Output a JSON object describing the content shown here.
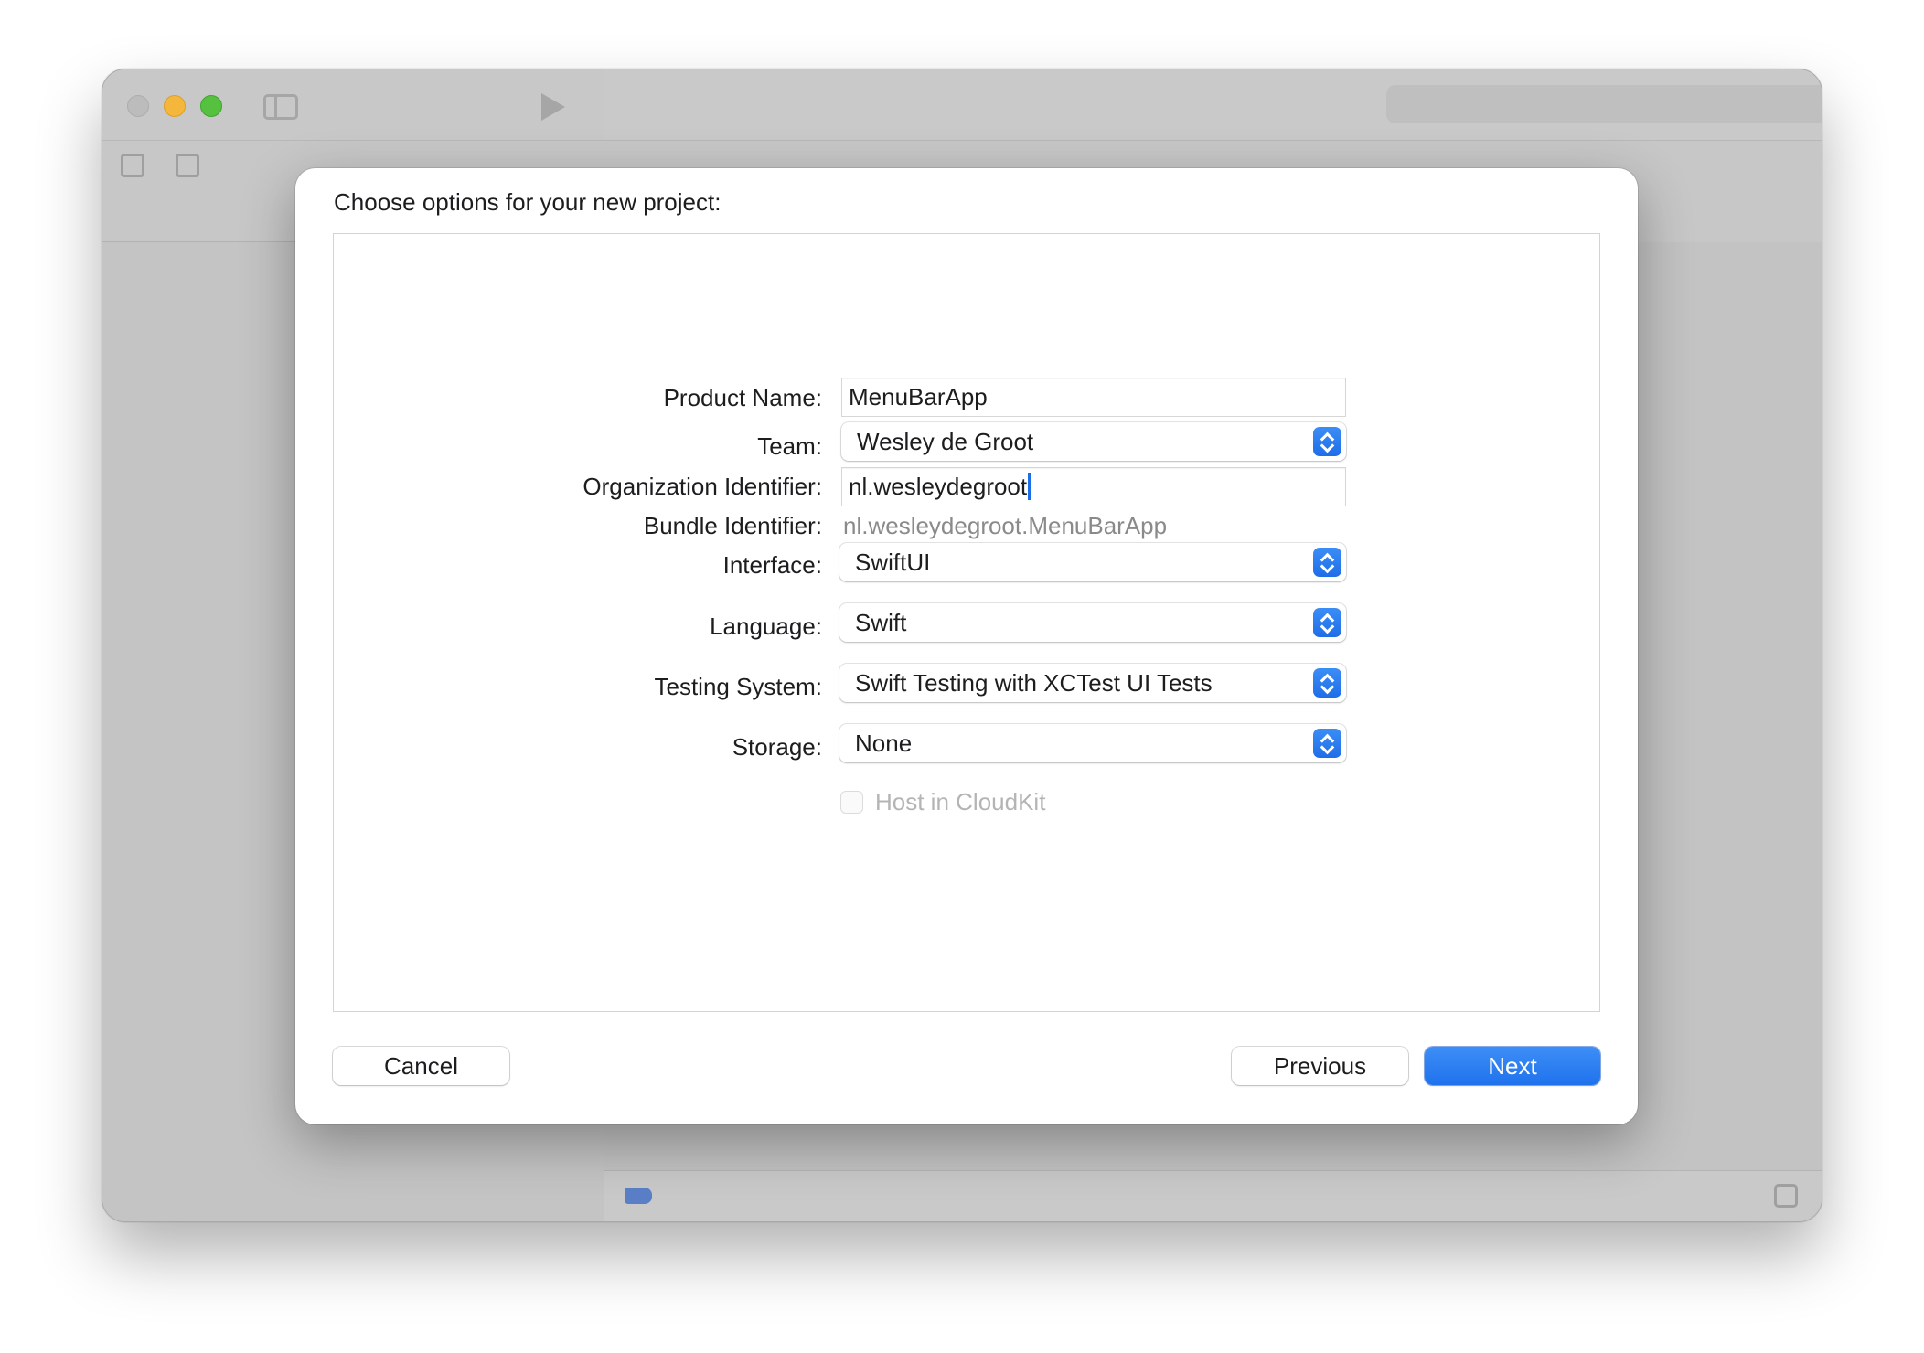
{
  "window": {
    "title_bar": {
      "traffic_lights": [
        "close",
        "minimize",
        "zoom"
      ]
    },
    "icons": {
      "sidebar_toggle": "sidebar-left-icon",
      "run": "play-icon",
      "library": "plus-icon",
      "inspector_toggle": "sidebar-right-icon",
      "navigator": [
        "folder-icon",
        "source-control-icon",
        "bookmark-icon",
        "search-icon",
        "warning-icon",
        "test-icon",
        "debug-icon",
        "breakpoint-icon",
        "report-icon"
      ]
    }
  },
  "dialog": {
    "title": "Choose options for your new project:",
    "fields": {
      "product_name": {
        "label": "Product Name:",
        "value": "MenuBarApp"
      },
      "team": {
        "label": "Team:",
        "value": "Wesley de Groot"
      },
      "organization_identifier": {
        "label": "Organization Identifier:",
        "value": "nl.wesleydegroot"
      },
      "bundle_identifier": {
        "label": "Bundle Identifier:",
        "value": "nl.wesleydegroot.MenuBarApp"
      },
      "interface": {
        "label": "Interface:",
        "value": "SwiftUI"
      },
      "language": {
        "label": "Language:",
        "value": "Swift"
      },
      "testing_system": {
        "label": "Testing System:",
        "value": "Swift Testing with XCTest UI Tests"
      },
      "storage": {
        "label": "Storage:",
        "value": "None"
      },
      "host_in_cloudkit": {
        "label": "Host in CloudKit",
        "checked": false,
        "enabled": false
      }
    },
    "buttons": {
      "cancel": "Cancel",
      "previous": "Previous",
      "next": "Next"
    },
    "colors": {
      "accent": "#1f72ec",
      "disabled_text": "#b4b4b4",
      "secondary_text": "#8a8a8a"
    }
  }
}
